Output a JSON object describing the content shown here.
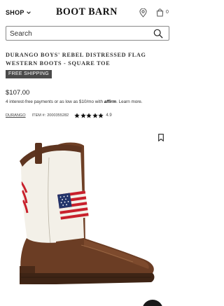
{
  "header": {
    "shop_label": "SHOP",
    "logo_text": "BOOT BARN",
    "cart_count": "0",
    "icons": {
      "menu": "chevron-down-icon",
      "store": "location-pin-icon",
      "cart": "shopping-bag-icon"
    }
  },
  "search": {
    "placeholder": "Search",
    "icon": "search-icon"
  },
  "product": {
    "title": "DURANGO BOYS' REBEL DISTRESSED FLAG WESTERN BOOTS - SQUARE TOE",
    "badge": "FREE SHIPPING",
    "price": "$107.00",
    "financing": {
      "text": "4 interest-free payments or as low as $10/mo with",
      "provider": "affirm",
      "link": "Learn more."
    },
    "brand": "DURANGO",
    "item_label": "ITEM #:",
    "item_number": "2000355282",
    "rating_value": "4.9",
    "rating_stars": 5,
    "wishlist_icon": "bookmark-icon"
  },
  "colors": {
    "text": "#222222",
    "badge_bg": "#4a4a4a",
    "boot_brown": "#6b3d24",
    "boot_shaft": "#f3f0e8",
    "flag_red": "#c8202c",
    "flag_blue": "#23356b"
  }
}
